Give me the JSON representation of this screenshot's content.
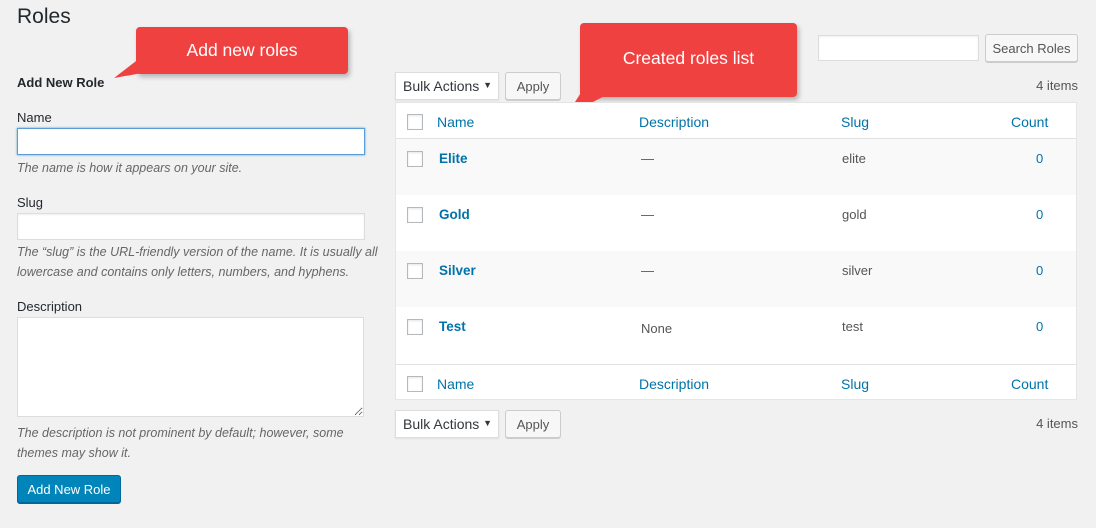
{
  "page": {
    "title": "Roles"
  },
  "callouts": {
    "add": "Add new roles",
    "list": "Created roles list"
  },
  "form": {
    "heading": "Add New Role",
    "name_label": "Name",
    "name_value": "",
    "name_help": "The name is how it appears on your site.",
    "slug_label": "Slug",
    "slug_value": "",
    "slug_help": "The “slug” is the URL-friendly version of the name. It is usually all lowercase and contains only letters, numbers, and hyphens.",
    "description_label": "Description",
    "description_value": "",
    "description_help": "The description is not prominent by default; however, some themes may show it.",
    "submit_label": "Add New Role"
  },
  "search": {
    "value": "",
    "button_label": "Search Roles"
  },
  "toolbar": {
    "bulk_actions_label": "Bulk Actions",
    "apply_label": "Apply",
    "items_count": "4 items"
  },
  "table": {
    "columns": {
      "name": "Name",
      "description": "Description",
      "slug": "Slug",
      "count": "Count"
    },
    "rows": [
      {
        "name": "Elite",
        "description": "—",
        "slug": "elite",
        "count": "0"
      },
      {
        "name": "Gold",
        "description": "—",
        "slug": "gold",
        "count": "0"
      },
      {
        "name": "Silver",
        "description": "—",
        "slug": "silver",
        "count": "0"
      },
      {
        "name": "Test",
        "description": "None",
        "slug": "test",
        "count": "0"
      }
    ]
  },
  "colors": {
    "primary": "#0085ba",
    "link": "#0073aa",
    "callout": "#f04141",
    "background": "#f1f1f1"
  }
}
